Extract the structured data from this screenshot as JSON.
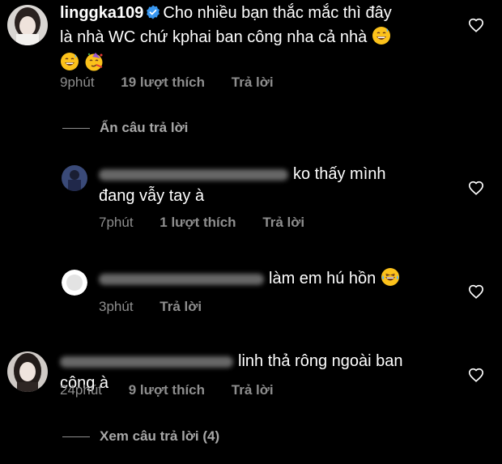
{
  "comments": [
    {
      "username": "linggka109",
      "text_line1": "Cho nhiều bạn thắc mắc thì đây",
      "text_line2": "là nhà WC chứ kphai ban công nha cả nhà",
      "time": "9phút",
      "likes": "19 lượt thích",
      "reply": "Trả lời"
    },
    {
      "text_line1": "ko thấy mình",
      "text_line2": "đang vẫy tay à",
      "time": "7phút",
      "likes": "1 lượt thích",
      "reply": "Trả lời"
    },
    {
      "text_line1": "làm em hú hồn",
      "time": "3phút",
      "reply": "Trả lời"
    },
    {
      "text_line1": "linh thả rông ngoài ban công à",
      "time": "24phút",
      "likes": "9 lượt thích",
      "reply": "Trả lời"
    }
  ],
  "threads": {
    "hide_replies": "Ẩn câu trả lời",
    "view_replies": "Xem câu trả lời (4)"
  },
  "icons": {
    "like": "heart-outline-icon",
    "verified": "verified-badge-icon",
    "emoji_sweat": "grinning-sweat-emoji",
    "emoji_party": "partying-face-emoji",
    "emoji_laugh": "tears-of-joy-emoji"
  },
  "colors": {
    "background": "#000000",
    "text": "#ffffff",
    "meta": "#8e8e8e",
    "verified": "#3897f0"
  }
}
